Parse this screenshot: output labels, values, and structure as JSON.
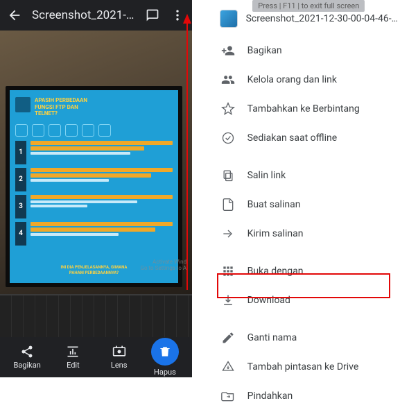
{
  "left": {
    "title": "Screenshot_2021-…",
    "bottom": {
      "share": "Bagikan",
      "edit": "Edit",
      "lens": "Lens",
      "delete": "Hapus"
    },
    "poster": {
      "heading_l1": "APASIH PERBEDAAN",
      "heading_l2": "FUNGSI FTP DAN",
      "heading_l3": "TELNET?",
      "footer_l1": "INI DIA PENJELASANNYA, GIMANA",
      "footer_l2": "PAHAM PERBEDAANNYA?"
    },
    "watermark_l1": "Activate Wind",
    "watermark_l2": "Go to Settings to A"
  },
  "right": {
    "hint": "Press | F11 | to exit full screen",
    "filename": "Screenshot_2021-12-30-00-04-46-…",
    "items": {
      "share": "Bagikan",
      "manage": "Kelola orang dan link",
      "star": "Tambahkan ke Berbintang",
      "offline": "Sediakan saat offline",
      "copylink": "Salin link",
      "makecopy": "Buat salinan",
      "sendcopy": "Kirim salinan",
      "openwith": "Buka dengan",
      "download": "Download",
      "rename": "Ganti nama",
      "addshortcut": "Tambah pintasan ke Drive",
      "move": "Pindahkan"
    }
  }
}
